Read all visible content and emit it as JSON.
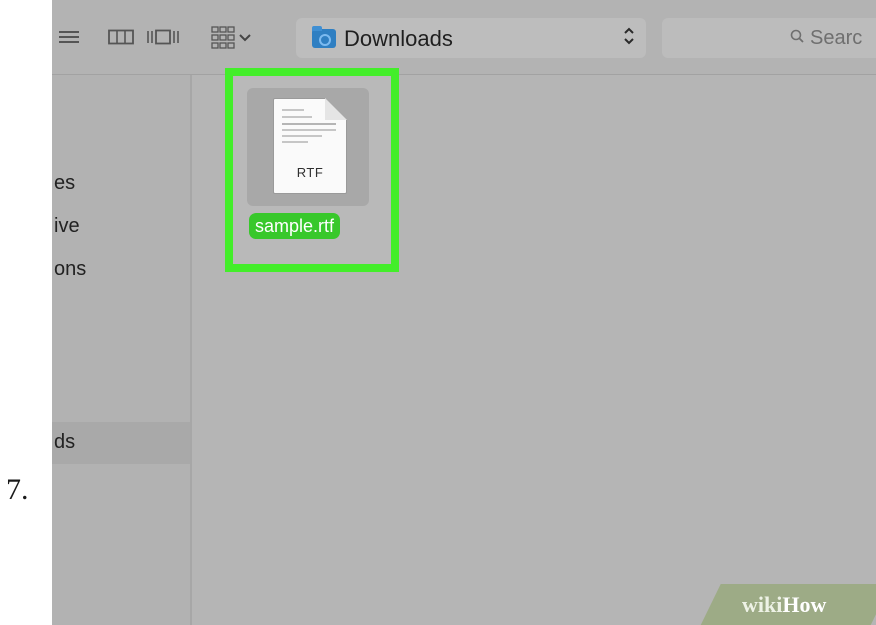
{
  "step_number": "7.",
  "toolbar": {
    "view_buttons": [
      "list-view",
      "column-view",
      "cover-flow-view"
    ],
    "arrange_button": "arrange",
    "path_popup": {
      "label": "Downloads",
      "icon": "folder-icon"
    },
    "search": {
      "placeholder": "Searc"
    }
  },
  "sidebar": {
    "items": [
      {
        "label": "es"
      },
      {
        "label": "ive"
      },
      {
        "label": "ons"
      },
      {
        "label": "ds",
        "selected": true
      }
    ]
  },
  "content": {
    "files": [
      {
        "name": "sample.rtf",
        "badge": "RTF",
        "selected": true
      }
    ]
  },
  "watermark": {
    "part1": "wiki",
    "part2": "How"
  },
  "colors": {
    "highlight": "#43ee2a",
    "selection": "#38c82b",
    "folder": "#2f7fc2",
    "background": "#b5b5b5"
  }
}
